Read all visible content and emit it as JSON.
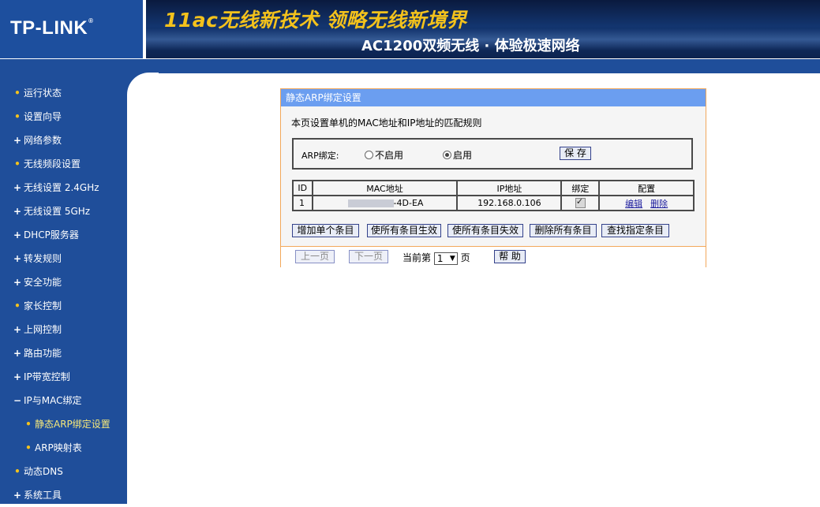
{
  "header": {
    "logo": "TP-LINK",
    "logo_mark": "®",
    "headline": "11ac无线新技术 领略无线新境界",
    "subline": "AC1200双频无线 · 体验极速网络"
  },
  "sidebar": {
    "items": [
      {
        "label": "运行状态",
        "mark": "•"
      },
      {
        "label": "设置向导",
        "mark": "•"
      },
      {
        "label": "网络参数",
        "mark": "+"
      },
      {
        "label": "无线频段设置",
        "mark": "•"
      },
      {
        "label": "无线设置 2.4GHz",
        "mark": "+"
      },
      {
        "label": "无线设置 5GHz",
        "mark": "+"
      },
      {
        "label": "DHCP服务器",
        "mark": "+"
      },
      {
        "label": "转发规则",
        "mark": "+"
      },
      {
        "label": "安全功能",
        "mark": "+"
      },
      {
        "label": "家长控制",
        "mark": "•"
      },
      {
        "label": "上网控制",
        "mark": "+"
      },
      {
        "label": "路由功能",
        "mark": "+"
      },
      {
        "label": "IP带宽控制",
        "mark": "+"
      },
      {
        "label": "IP与MAC绑定",
        "mark": "−"
      },
      {
        "label": "静态ARP绑定设置",
        "mark": "•"
      },
      {
        "label": "ARP映射表",
        "mark": "•"
      },
      {
        "label": "动态DNS",
        "mark": "•"
      },
      {
        "label": "系统工具",
        "mark": "+"
      }
    ]
  },
  "panel": {
    "title": "静态ARP绑定设置",
    "description": "本页设置单机的MAC地址和IP地址的匹配规则",
    "arp_label": "ARP绑定:",
    "radio_off": "不启用",
    "radio_on": "启用",
    "radio_selected": "启用",
    "save_label": "保 存",
    "table": {
      "headers": [
        "ID",
        "MAC地址",
        "IP地址",
        "绑定",
        "配置"
      ],
      "rows": [
        {
          "id": "1",
          "mac": "-4D-EA",
          "ip": "192.168.0.106",
          "bound": true,
          "edit": "编辑",
          "delete": "删除"
        }
      ]
    },
    "actions": {
      "add": "增加单个条目",
      "enable_all": "使所有条目生效",
      "disable_all": "使所有条目失效",
      "delete_all": "删除所有条目",
      "find": "查找指定条目"
    },
    "footer": {
      "prev": "上一页",
      "next": "下一页",
      "current_prefix": "当前第",
      "page": "1",
      "page_suffix": "页",
      "help": "帮 助"
    }
  },
  "colors": {
    "nav_bg": "#1f4e9a",
    "panel_title_bg": "#6b9ef0",
    "panel_border": "#f2a85b",
    "headline": "#f3c21c"
  }
}
